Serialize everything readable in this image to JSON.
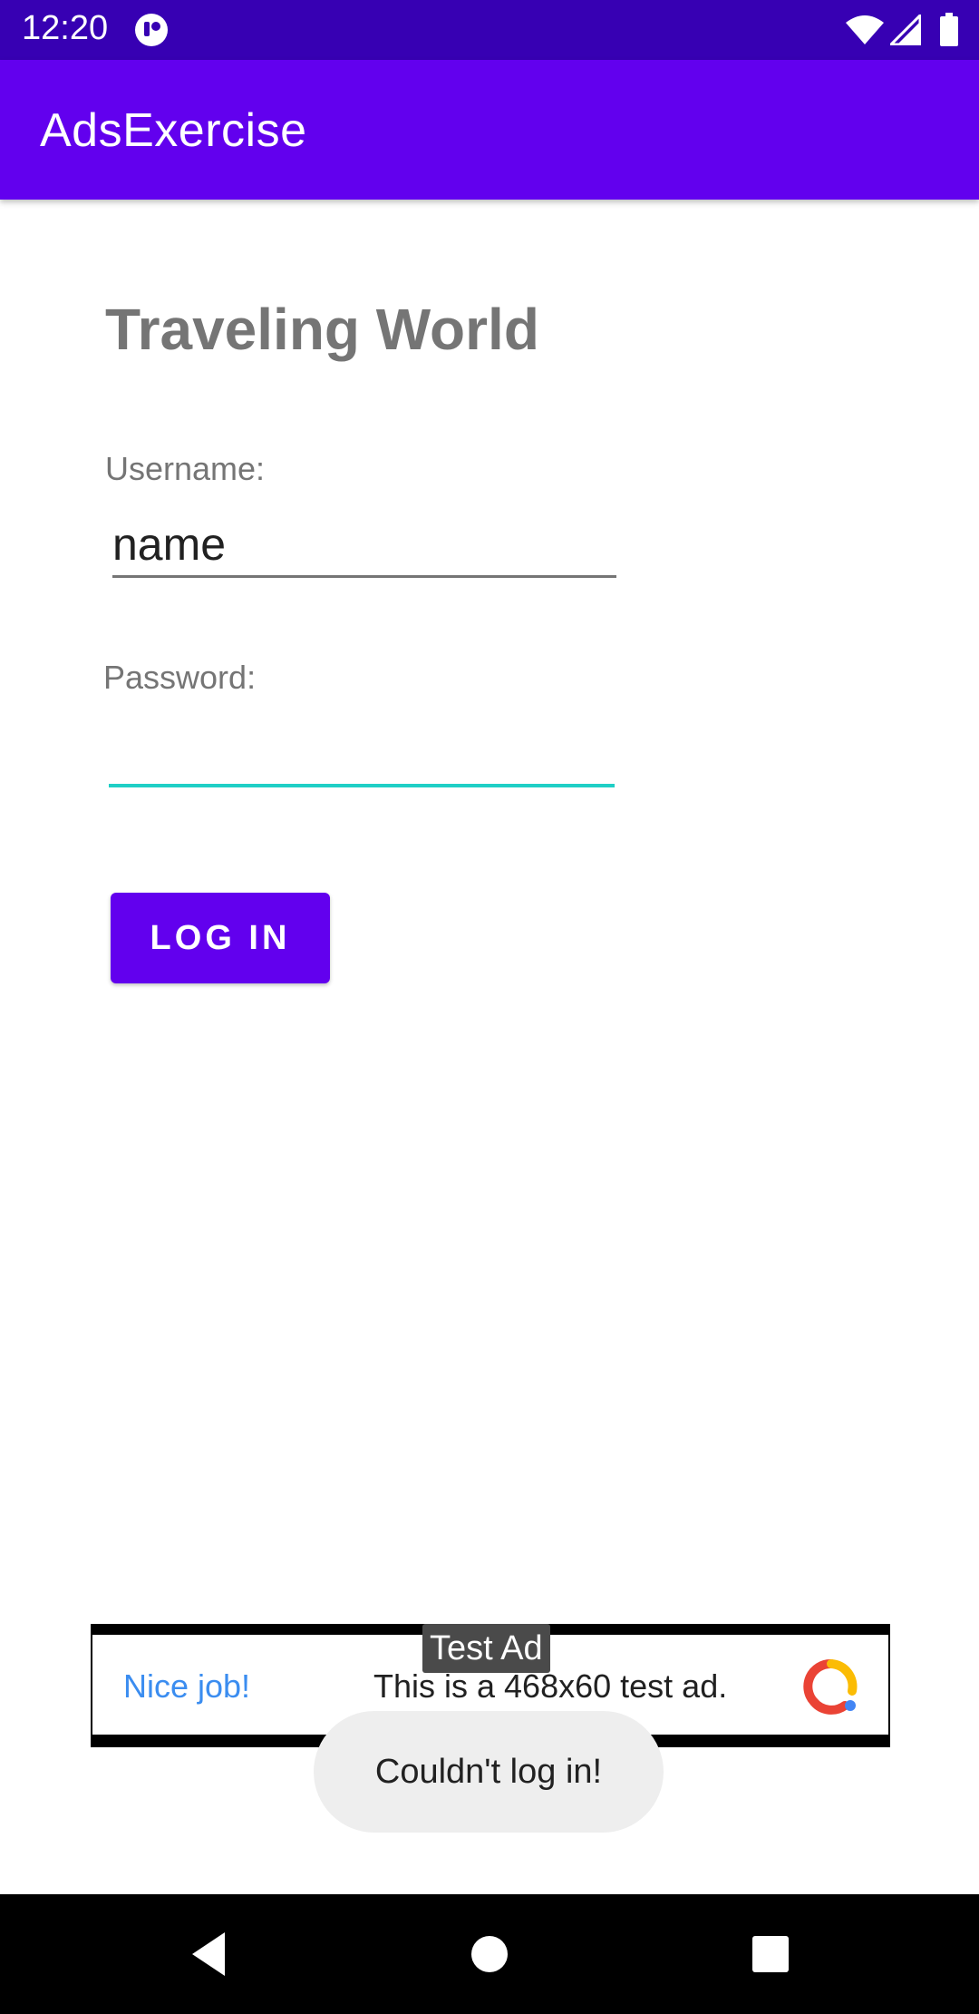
{
  "status_bar": {
    "time": "12:20",
    "icons": [
      "notification-icon",
      "wifi-icon",
      "signal-icon",
      "battery-icon"
    ]
  },
  "app_bar": {
    "title": "AdsExercise",
    "color": "#6200ee"
  },
  "main": {
    "heading": "Traveling World",
    "username_label": "Username:",
    "username_value": "name",
    "password_label": "Password:",
    "password_value": "",
    "login_button": "LOG IN"
  },
  "ad": {
    "badge": "Test Ad",
    "headline": "Nice job!",
    "body": "This is a 468x60 test ad.",
    "icon": "admob-logo-icon"
  },
  "toast": {
    "message": "Couldn't log in!"
  },
  "nav_bar": {
    "icons": [
      "back-icon",
      "home-icon",
      "recents-icon"
    ]
  },
  "colors": {
    "status_bar": "#3700b3",
    "accent": "#6200ee",
    "focused_underline": "#1fcfc6",
    "ad_headline": "#3b8df0"
  }
}
